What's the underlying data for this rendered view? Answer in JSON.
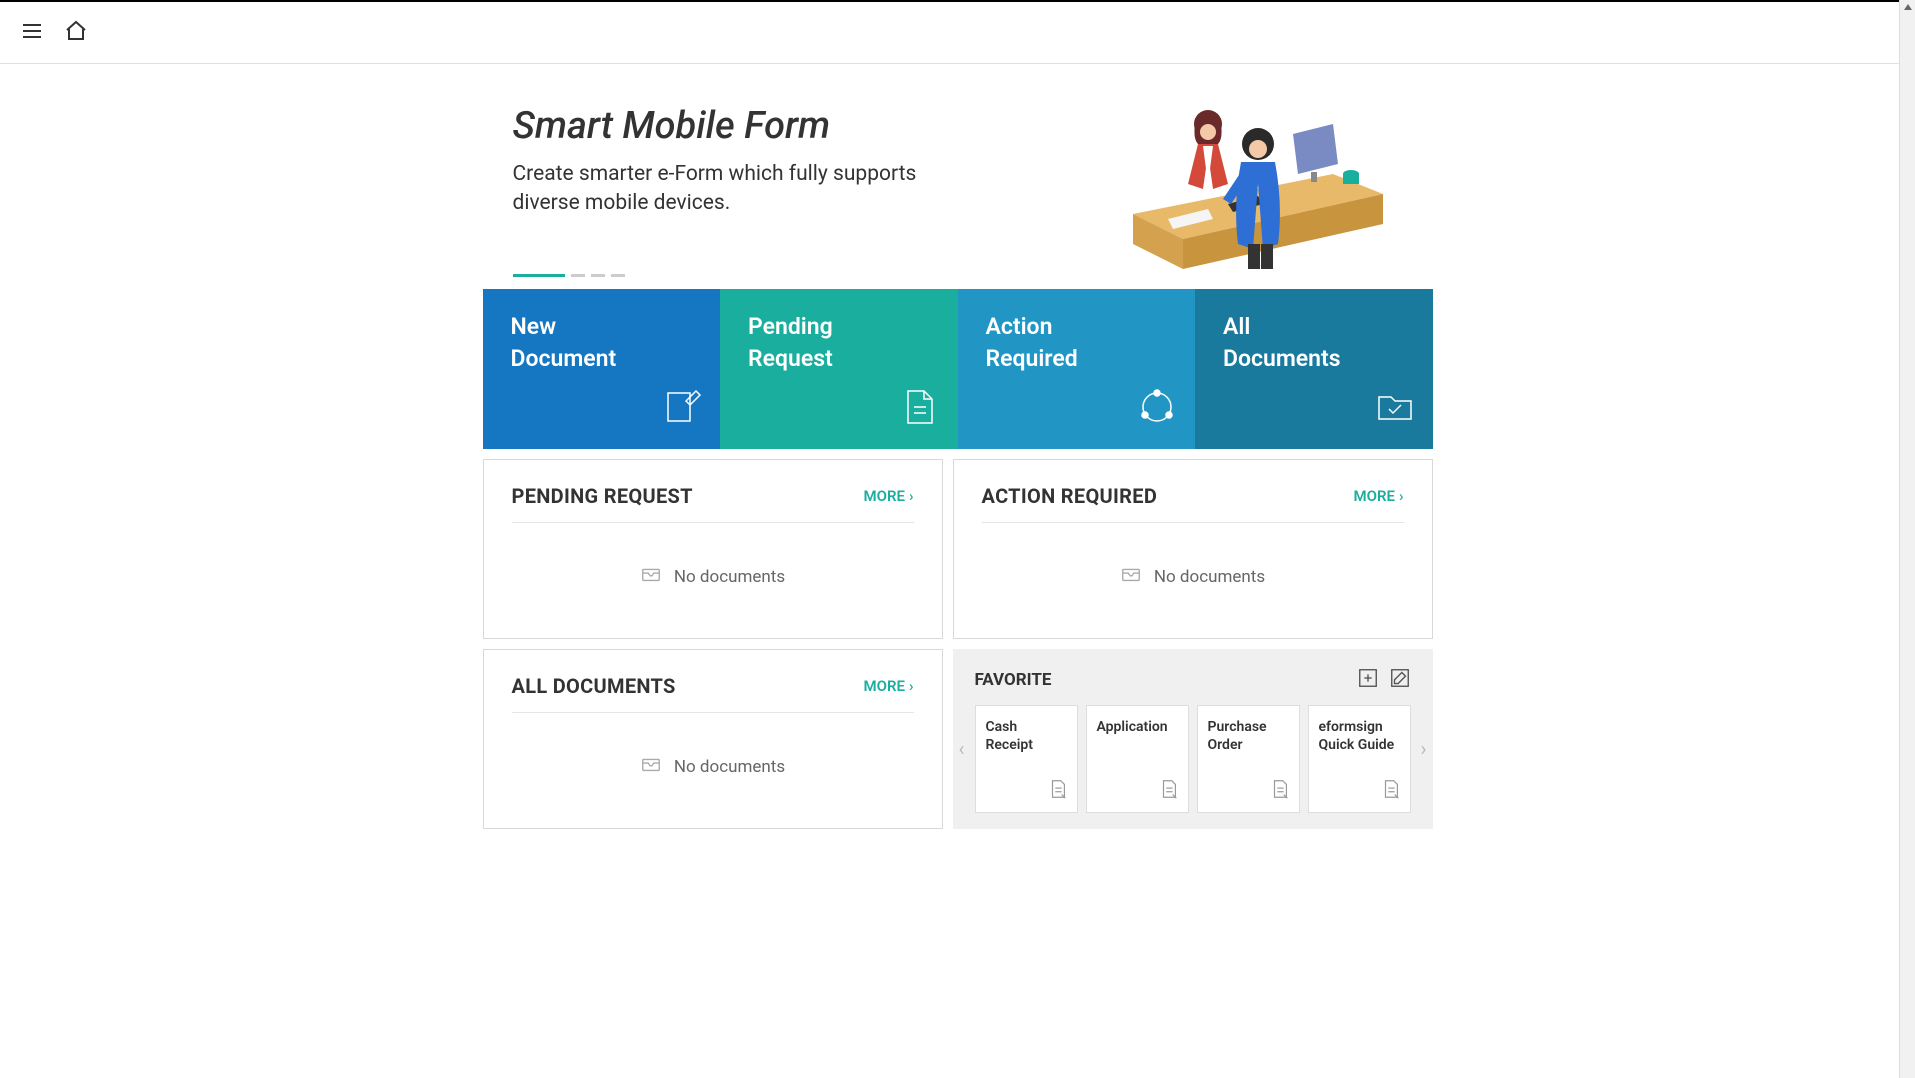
{
  "hero": {
    "title": "Smart Mobile Form",
    "subtitle": "Create smarter e-Form which fully supports diverse mobile devices."
  },
  "tiles": [
    {
      "label": "New\nDocument"
    },
    {
      "label": "Pending\nRequest"
    },
    {
      "label": "Action\nRequired"
    },
    {
      "label": "All\nDocuments"
    }
  ],
  "panels": {
    "pending": {
      "title": "PENDING REQUEST",
      "more": "MORE",
      "empty": "No documents"
    },
    "action": {
      "title": "ACTION REQUIRED",
      "more": "MORE",
      "empty": "No documents"
    },
    "all": {
      "title": "ALL DOCUMENTS",
      "more": "MORE",
      "empty": "No documents"
    },
    "favorite": {
      "title": "FAVORITE"
    }
  },
  "favorites": [
    {
      "title": "Cash Receipt"
    },
    {
      "title": "Application"
    },
    {
      "title": "Purchase Order"
    },
    {
      "title": "eformsign Quick Guide"
    }
  ]
}
